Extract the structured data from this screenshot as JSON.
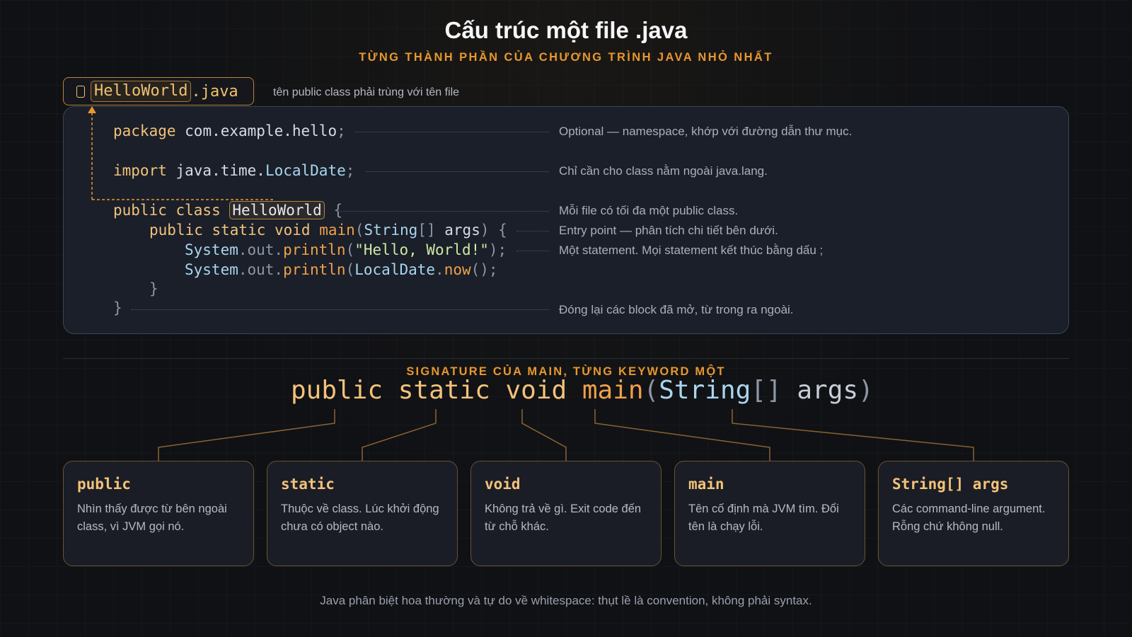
{
  "title": "Cấu trúc một file .java",
  "subtitle": "TỪNG THÀNH PHẦN CỦA CHƯƠNG TRÌNH JAVA NHỎ NHẤT",
  "file_tab": {
    "name": "HelloWorld",
    "ext": ".java",
    "note": "tên public class phải trùng với tên file",
    "icon": "file-icon"
  },
  "code": {
    "package_kw": "package",
    "package_path": " com.example.hello",
    "semicolon": ";",
    "import_kw": "import",
    "import_path": " java.time.",
    "import_type": "LocalDate",
    "class_kw": "public class",
    "class_name": "HelloWorld",
    "brace_open": "{",
    "main_mods": "public static void",
    "main_name": "main",
    "paren_open": "(",
    "string_type": "String",
    "array_brackets": "[]",
    "args_name": " args",
    "paren_close": ")",
    "system": "System",
    "dot_out_dot": ".out.",
    "println": "println",
    "hello_str": "\"Hello, World!\"",
    "close_call": ");",
    "localdate": "LocalDate",
    "dot": ".",
    "now": "now",
    "call_close": "();",
    "brace_close": "}"
  },
  "notes": {
    "package": "Optional — namespace, khớp với đường dẫn thư mục.",
    "import": "Chỉ cần cho class nằm ngoài java.lang.",
    "class": "Mỗi file có tối đa một public class.",
    "main": "Entry point — phân tích chi tiết bên dưới.",
    "statement": "Một statement. Mọi statement kết thúc bằng dấu ;",
    "close": "Đóng lại các block đã mở, từ trong ra ngoài."
  },
  "signature": {
    "label": "SIGNATURE CỦA MAIN, TỪNG KEYWORD MỘT",
    "public": "public",
    "static": "static",
    "void": "void",
    "main": "main",
    "paren_open": "(",
    "string": "String",
    "brackets": "[]",
    "args": "args",
    "paren_close": ")"
  },
  "cards": [
    {
      "title": "public",
      "body": "Nhìn thấy được từ bên ngoài class, vì JVM gọi nó."
    },
    {
      "title": "static",
      "body": "Thuộc về class. Lúc khởi động chưa có object nào."
    },
    {
      "title": "void",
      "body": "Không trả về gì. Exit code đến từ chỗ khác."
    },
    {
      "title": "main",
      "body": "Tên cố định mà JVM tìm. Đổi tên là chạy lỗi."
    },
    {
      "title": "String[] args",
      "body": "Các command-line argument. Rỗng chứ không null."
    }
  ],
  "footer": "Java phân biệt hoa thường và tự do về whitespace: thụt lề là convention, không phải syntax.",
  "colors": {
    "accent": "#e8972f",
    "keyword": "#f3c27a",
    "type": "#a9d5ee",
    "string": "#cfe8a5",
    "background": "#0f1115"
  }
}
